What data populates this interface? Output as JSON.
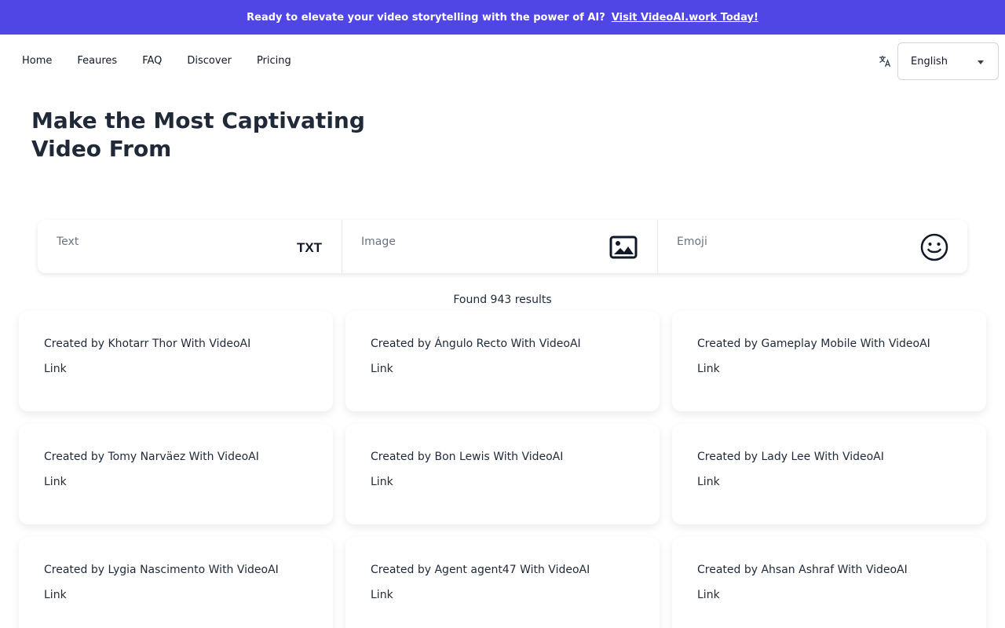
{
  "banner": {
    "text": "Ready to elevate your video storytelling with the power of AI?",
    "link": "Visit VideoAI.work Today!"
  },
  "nav": {
    "links": [
      "Home",
      "Feaures",
      "FAQ",
      "Discover",
      "Pricing"
    ],
    "language": "English",
    "language_icon": "translate-icon"
  },
  "hero": {
    "title": "Make the Most Captivating Video From"
  },
  "search": {
    "segments": [
      {
        "label": "Text",
        "icon": "txt-icon"
      },
      {
        "label": "Image",
        "icon": "image-icon"
      },
      {
        "label": "Emoji",
        "icon": "smiley-icon"
      }
    ]
  },
  "results": {
    "text": "Found 943 results"
  },
  "cards": [
    {
      "title": "Created by Khotarr Thor With VideoAI",
      "link": "Link"
    },
    {
      "title": "Created by Ángulo Recto With VideoAI",
      "link": "Link"
    },
    {
      "title": "Created by Gameplay Mobile With VideoAI",
      "link": "Link"
    },
    {
      "title": "Created by Tomy Narväez With VideoAI",
      "link": "Link"
    },
    {
      "title": "Created by Bon Lewis With VideoAI",
      "link": "Link"
    },
    {
      "title": "Created by Lady Lee With VideoAI",
      "link": "Link"
    },
    {
      "title": "Created by Lygia Nascimento With VideoAI",
      "link": "Link"
    },
    {
      "title": "Created by Agent agent47 With VideoAI",
      "link": "Link"
    },
    {
      "title": "Created by Ahsan Ashraf With VideoAI",
      "link": "Link"
    }
  ],
  "colors": {
    "banner_bg": "#4f46e5",
    "text": "#1f2937"
  }
}
